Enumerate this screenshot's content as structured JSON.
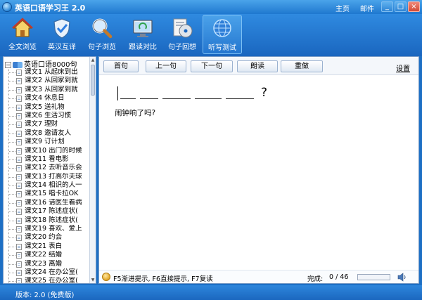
{
  "app": {
    "title": "英语口语学习王 2.0",
    "links": [
      "主页",
      "邮件"
    ]
  },
  "window_controls": [
    "_",
    "□",
    "×"
  ],
  "toolbar": [
    {
      "label": "全文浏览",
      "icon": "house-icon"
    },
    {
      "label": "英汉互译",
      "icon": "shield-check-icon"
    },
    {
      "label": "句子浏览",
      "icon": "magnifier-icon"
    },
    {
      "label": "跟读对比",
      "icon": "monitor-recycle-icon"
    },
    {
      "label": "句子回想",
      "icon": "cd-icon"
    },
    {
      "label": "听写测试",
      "icon": "globe-icon",
      "active": true
    }
  ],
  "sidebar": {
    "root": "英语口语8000句",
    "lessons": [
      "课文1 从起床到出",
      "课文2 从回家到就",
      "课文3 从回家到就",
      "课文4 休息日",
      "课文5 送礼物",
      "课文6 生活习惯",
      "课文7 理财",
      "课文8 邀请友人",
      "课文9 订计划",
      "课文10 出门的时候",
      "课文11 看电影",
      "课文12 去听音乐会",
      "课文13 打高尔夫球",
      "课文14 相识的人一",
      "课文15 唱卡拉OK",
      "课文16 请医生看病",
      "课文17 陈述症状(",
      "课文18 陈述症状(",
      "课文19 喜欢、爱上",
      "课文20 约会",
      "课文21 表白",
      "课文22 结婚",
      "课文23 离婚",
      "课文24 在办公室(",
      "课文25 在办公室("
    ]
  },
  "actions": [
    "首句",
    "上一句",
    "下一句",
    "朗读",
    "重做"
  ],
  "settings_label": "设置",
  "exercise": {
    "blank_count": 6,
    "end_punct": "?",
    "translation": "闹钟响了吗?"
  },
  "hint": "F5渐进提示, F6直接提示, F7复读",
  "progress": {
    "label": "完成:",
    "done": 0,
    "total": 46,
    "text": "0 / 46"
  },
  "status": "版本: 2.0 (免费版)",
  "colors": {
    "titlebar": "#2a86d6",
    "toolbar": "#1a66bf",
    "panel_border": "#7a9cc6"
  }
}
